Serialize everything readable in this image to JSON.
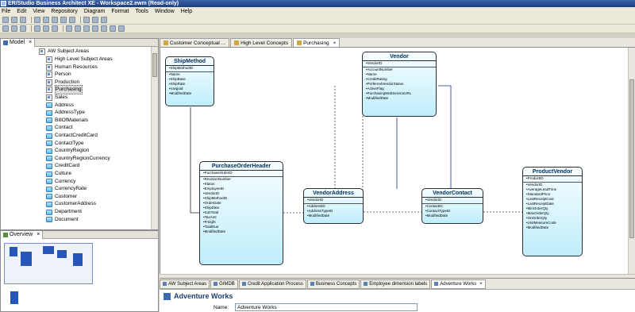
{
  "window": {
    "title": "ER/Studio Business Architect XE - Workspace2.ewm (Read-only)"
  },
  "menu": {
    "items": [
      "File",
      "Edit",
      "View",
      "Repository",
      "Diagram",
      "Format",
      "Tools",
      "Window",
      "Help"
    ]
  },
  "model_pane": {
    "tab_label": "Model",
    "root": "AW Subject Areas",
    "items": [
      {
        "label": "High Level Subject Areas",
        "type": "subject"
      },
      {
        "label": "Human Resources",
        "type": "subject"
      },
      {
        "label": "Person",
        "type": "subject"
      },
      {
        "label": "Production",
        "type": "subject"
      },
      {
        "label": "Purchasing",
        "type": "subject",
        "selected": true
      },
      {
        "label": "Sales",
        "type": "subject"
      },
      {
        "label": "Address",
        "type": "entity"
      },
      {
        "label": "AddressType",
        "type": "entity"
      },
      {
        "label": "BillOfMaterials",
        "type": "entity"
      },
      {
        "label": "Contact",
        "type": "entity"
      },
      {
        "label": "ContactCreditCard",
        "type": "entity"
      },
      {
        "label": "ContactType",
        "type": "entity"
      },
      {
        "label": "CountryRegion",
        "type": "entity"
      },
      {
        "label": "CountryRegionCurrency",
        "type": "entity"
      },
      {
        "label": "CreditCard",
        "type": "entity"
      },
      {
        "label": "Culture",
        "type": "entity"
      },
      {
        "label": "Currency",
        "type": "entity"
      },
      {
        "label": "CurrencyRate",
        "type": "entity"
      },
      {
        "label": "Customer",
        "type": "entity"
      },
      {
        "label": "CustomerAddress",
        "type": "entity"
      },
      {
        "label": "Department",
        "type": "entity"
      },
      {
        "label": "Document",
        "type": "entity"
      }
    ]
  },
  "overview_pane": {
    "tab_label": "Overview"
  },
  "diagram_tabs": [
    {
      "label": "Customer Conceptual ...",
      "active": false
    },
    {
      "label": "High Level Concepts",
      "active": false
    },
    {
      "label": "Purchasing",
      "active": true
    }
  ],
  "entities": {
    "shipmethod": {
      "name": "ShipMethod",
      "attrs": [
        "ShipMethodID",
        "Name",
        "ShipBase",
        "ShipRate",
        "rowguid",
        "ModifiedDate"
      ]
    },
    "vendor": {
      "name": "Vendor",
      "attrs": [
        "VendorID",
        "AccountNumber",
        "Name",
        "CreditRating",
        "PreferredVendorStatus",
        "ActiveFlag",
        "PurchasingWebServiceURL",
        "ModifiedDate"
      ]
    },
    "poh": {
      "name": "PurchaseOrderHeader",
      "attrs": [
        "PurchaseOrderID",
        "RevisionNumber",
        "Status",
        "EmployeeID",
        "VendorID",
        "ShipMethodID",
        "OrderDate",
        "ShipDate",
        "SubTotal",
        "TaxAmt",
        "Freight",
        "TotalDue",
        "ModifiedDate"
      ]
    },
    "vendoraddress": {
      "name": "VendorAddress",
      "attrs": [
        "VendorID",
        "AddressID",
        "AddressTypeID",
        "ModifiedDate"
      ]
    },
    "vendorcontact": {
      "name": "VendorContact",
      "attrs": [
        "VendorID",
        "ContactID",
        "ContactTypeID",
        "ModifiedDate"
      ]
    },
    "productvendor": {
      "name": "ProductVendor",
      "attrs": [
        "ProductID",
        "VendorID",
        "AverageLeadTime",
        "StandardPrice",
        "LastReceiptCost",
        "LastReceiptDate",
        "MinOrderQty",
        "MaxOrderQty",
        "OnOrderQty",
        "UnitMeasureCode",
        "ModifiedDate"
      ]
    }
  },
  "bottom_tabs": [
    {
      "label": "AW Subject Areas",
      "active": false
    },
    {
      "label": "GIMDB",
      "active": false
    },
    {
      "label": "Credit Application Process",
      "active": false
    },
    {
      "label": "Business Concepts",
      "active": false
    },
    {
      "label": "Employee dimension labels",
      "active": false
    },
    {
      "label": "Adventure Works",
      "active": true
    }
  ],
  "properties": {
    "title": "Adventure Works",
    "name_label": "Name:",
    "name_value": "Adventure Works"
  }
}
